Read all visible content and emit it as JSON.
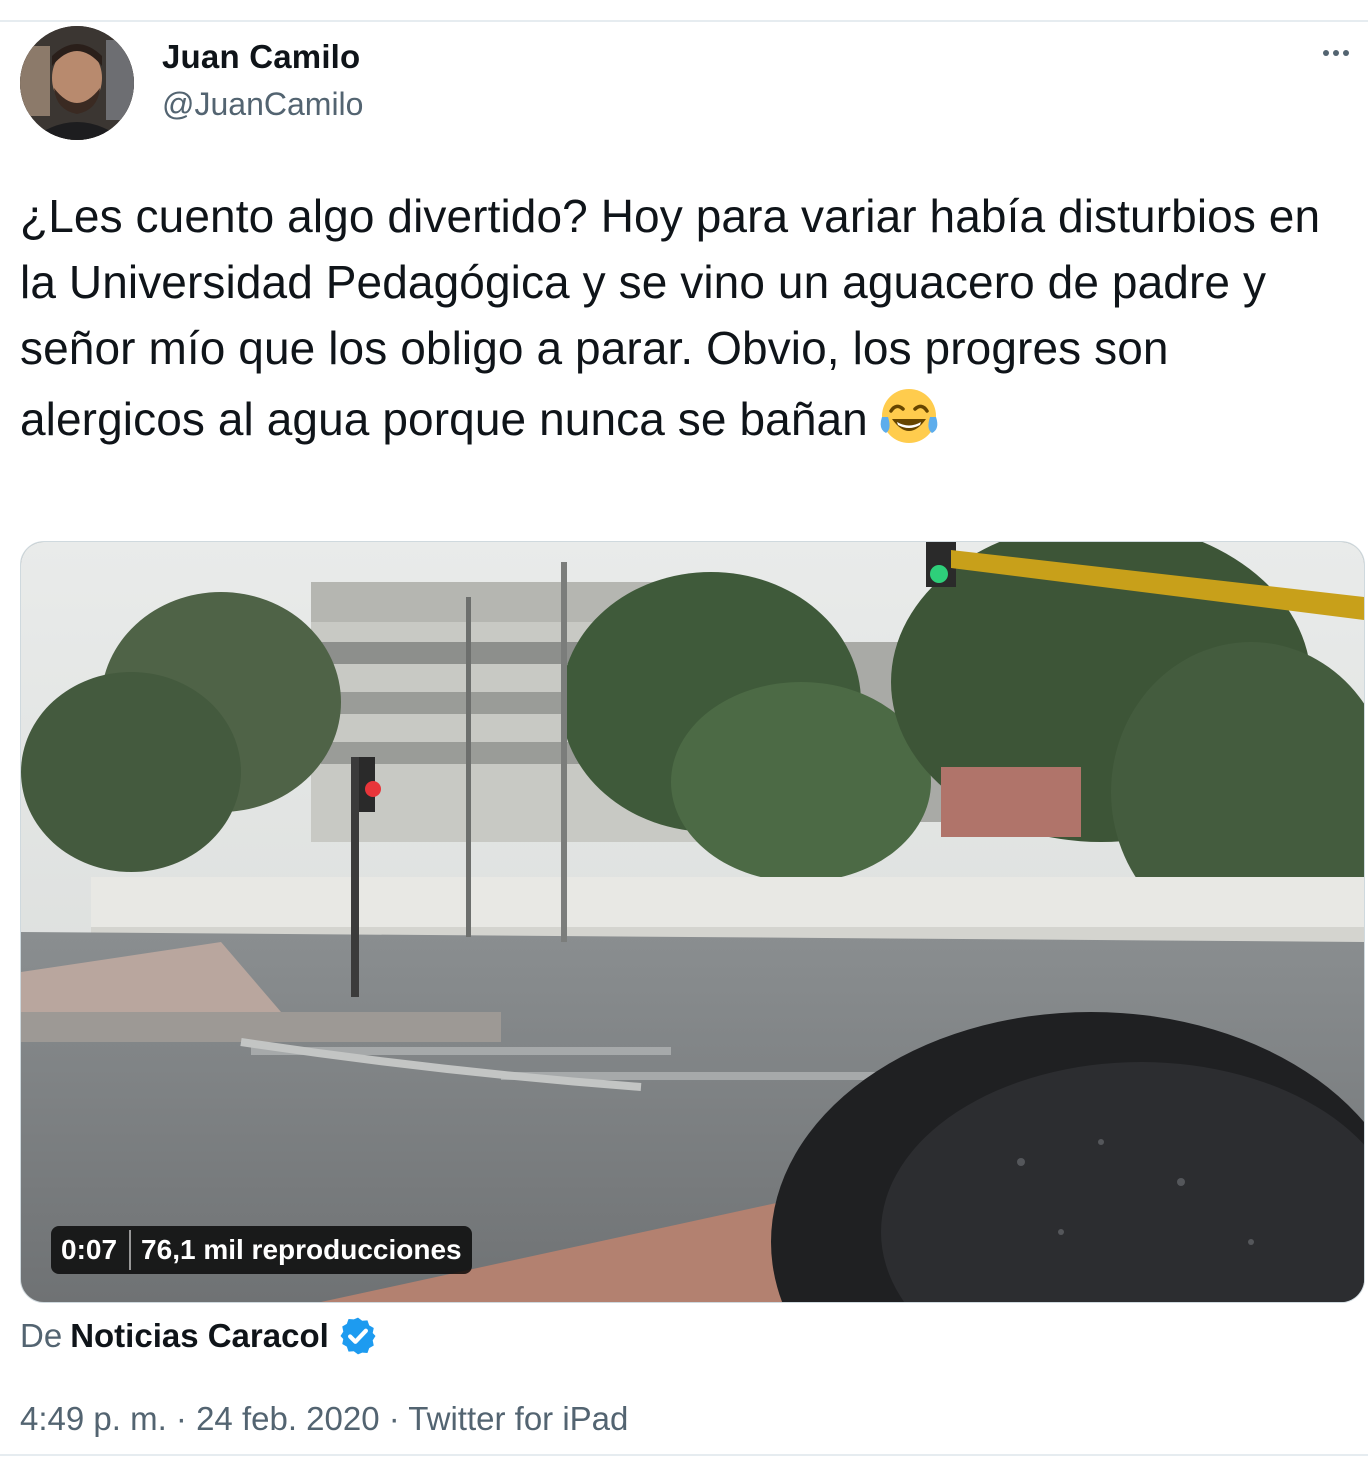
{
  "tweet": {
    "author": {
      "display_name": "Juan Camilo",
      "handle": "@JuanCamilo",
      "avatar_icon": "user-avatar"
    },
    "more_icon": "more-horizontal-icon",
    "text": "¿Les cuento algo divertido? Hoy para variar había disturbios en la Universidad Pedagógica y se vino un aguacero de padre y señor mío que los obligo a parar. Obvio, los progres son alergicos al agua porque nunca se bañan",
    "emoji": "face-with-tears-of-joy",
    "media": {
      "type": "video",
      "duration": "0:07",
      "views": "76,1 mil reproducciones"
    },
    "source": {
      "prefix": "De",
      "name": "Noticias Caracol",
      "verified_icon": "verified-badge-icon"
    },
    "meta": "4:49 p. m. · 24 feb. 2020 · Twitter for iPad"
  },
  "colors": {
    "text_primary": "#0f1419",
    "text_secondary": "#536471",
    "verified_blue": "#1d9bf0"
  }
}
